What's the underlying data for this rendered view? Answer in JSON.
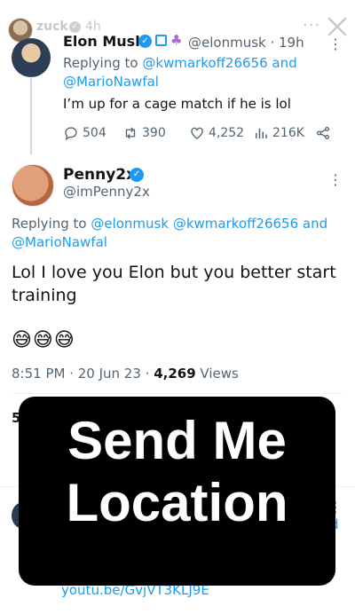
{
  "story": {
    "username": "zuck",
    "verified_mark": "✓",
    "time": "4h",
    "more_label": "···",
    "icons": [
      "avatar",
      "verified-icon",
      "more-icon",
      "close-icon"
    ]
  },
  "tweet1": {
    "name": "Elon Musk",
    "handle_time": "@elonmusk · 19h",
    "replying_prefix": "Replying to ",
    "replying_link1": "@kwmarkoff26656",
    "replying_and": " and",
    "replying_link2": "@MarioNawfal",
    "text": "I’m up for a cage match if he is lol",
    "replies": "504",
    "retweets": "390",
    "likes": "4,252",
    "views": "216K"
  },
  "tweet2": {
    "name": "Penny2x",
    "handle": "@imPenny2x",
    "replying_prefix": "Replying to ",
    "replying_link1": "@elonmusk",
    "replying_link2": "@kwmarkoff26656",
    "replying_and": " and",
    "replying_link3": "@MarioNawfal",
    "text": "Lol I love you Elon but you better start training",
    "emojis": "😅😅😅",
    "timestamp": "8:51 PM · 20 Jun 23 · ",
    "views_count": "4,269",
    "views_label": " Views",
    "partial_count": "5"
  },
  "partial_tweet": {
    "link_fragment": "d",
    "url_fragment": "youtu.be/GvjVT3KLJ9E"
  },
  "sticker": {
    "text_line1": "Send Me",
    "text_line2": "Location"
  },
  "colors": {
    "link": "#1d9bf0",
    "secondary_text": "#536471",
    "sticker_bg": "#000000"
  }
}
